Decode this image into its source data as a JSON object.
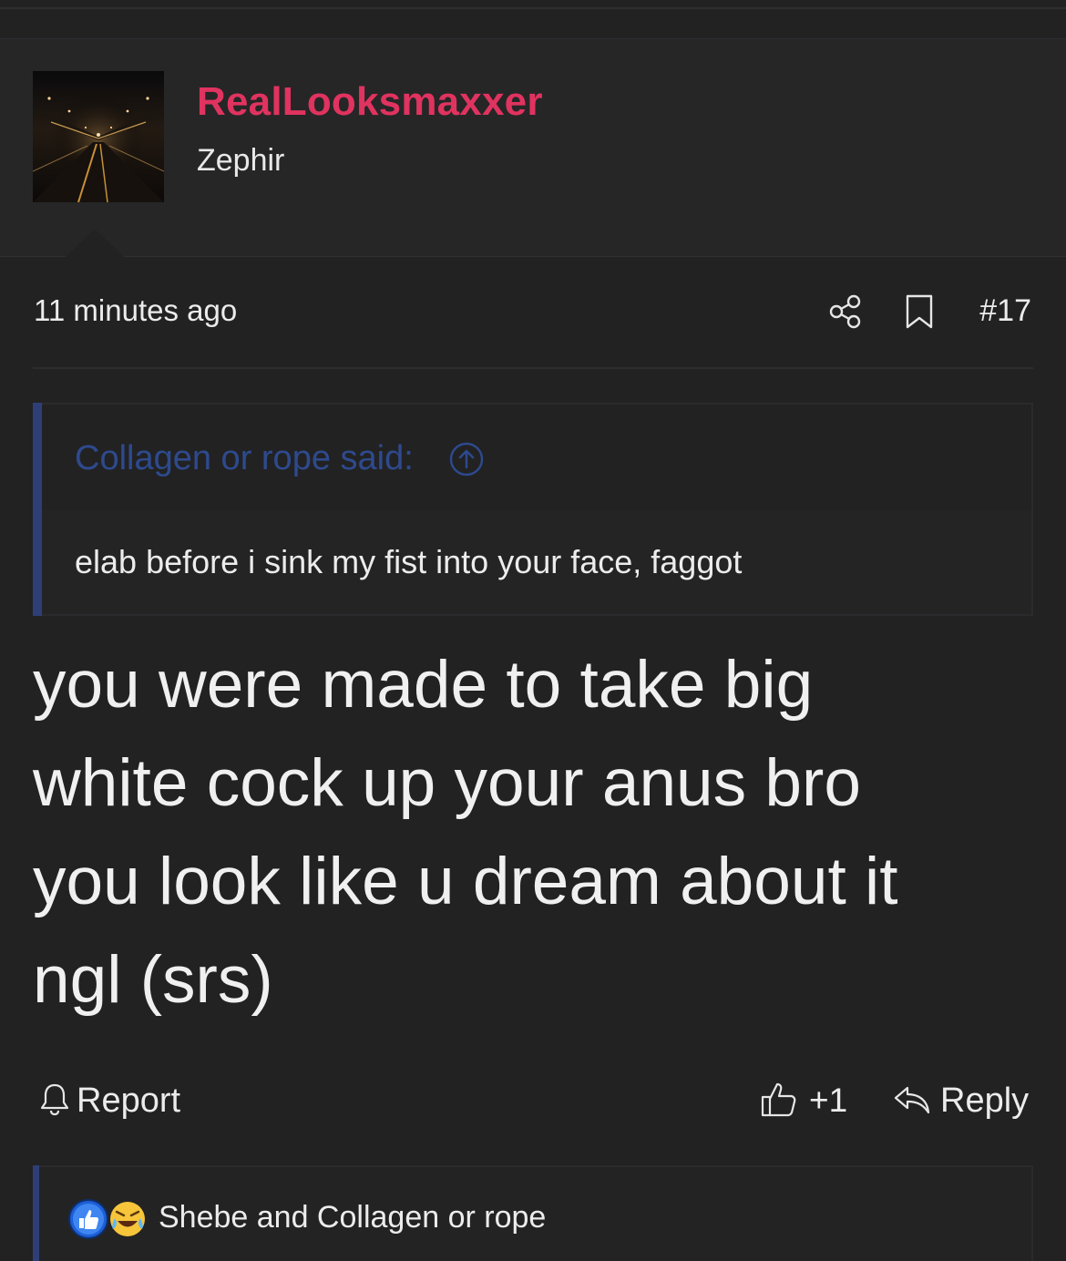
{
  "user": {
    "name": "RealLooksmaxxer",
    "title": "Zephir",
    "name_color": "#e0335f"
  },
  "post": {
    "time": "11 minutes ago",
    "number": "#17",
    "body_lines": [
      "you were made to take big",
      "white cock up your anus bro",
      "you look like u dream about it",
      "ngl (srs)"
    ]
  },
  "quote": {
    "author_label": "Collagen or rope said:",
    "text": "elab before i sink my fist into your face, faggot",
    "accent_color": "#2e3f77"
  },
  "actions": {
    "report_label": "Report",
    "like_count": "+1",
    "reply_label": "Reply"
  },
  "reactions": {
    "summary": "Shebe and Collagen or rope",
    "icons": [
      "like-reaction-icon",
      "laugh-cry-reaction-icon"
    ]
  },
  "icons": {
    "share": "share-icon",
    "bookmark": "bookmark-icon",
    "quote_jump": "arrow-up-circle-icon",
    "report": "bell-icon",
    "like": "thumbs-up-icon",
    "reply": "reply-arrow-icon"
  },
  "colors": {
    "background": "#222223",
    "text": "#ececec",
    "quote_link": "#2e4a8e"
  }
}
